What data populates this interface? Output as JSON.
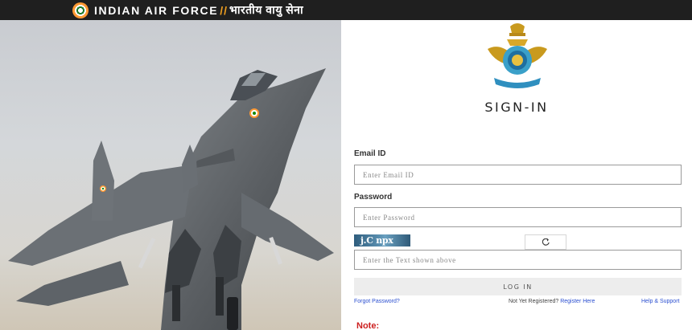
{
  "header": {
    "brand_en": "INDIAN AIR FORCE",
    "separator": "//",
    "brand_hi": "भारतीय वायु सेना"
  },
  "login": {
    "title": "SIGN-IN",
    "email_label": "Email ID",
    "email_placeholder": "Enter Email ID",
    "email_value": "",
    "password_label": "Password",
    "password_placeholder": "Enter Password",
    "password_value": "",
    "captcha_text": "j.C npx",
    "captcha_placeholder": "Enter the Text shown above",
    "captcha_value": "",
    "login_button": "LOG IN",
    "forgot_password": "Forgot Password?",
    "not_registered": "Not Yet Registered?",
    "register_here": "Register Here",
    "help_support": "Help & Support",
    "note_label": "Note:"
  },
  "icons": {
    "roundel": "iaf-roundel-icon",
    "refresh": "refresh-icon",
    "emblem": "iaf-emblem-icon"
  },
  "colors": {
    "header_bg": "#1f1f1f",
    "separator": "#f0a020",
    "link": "#2b4fd0",
    "note": "#cc1f1f"
  }
}
